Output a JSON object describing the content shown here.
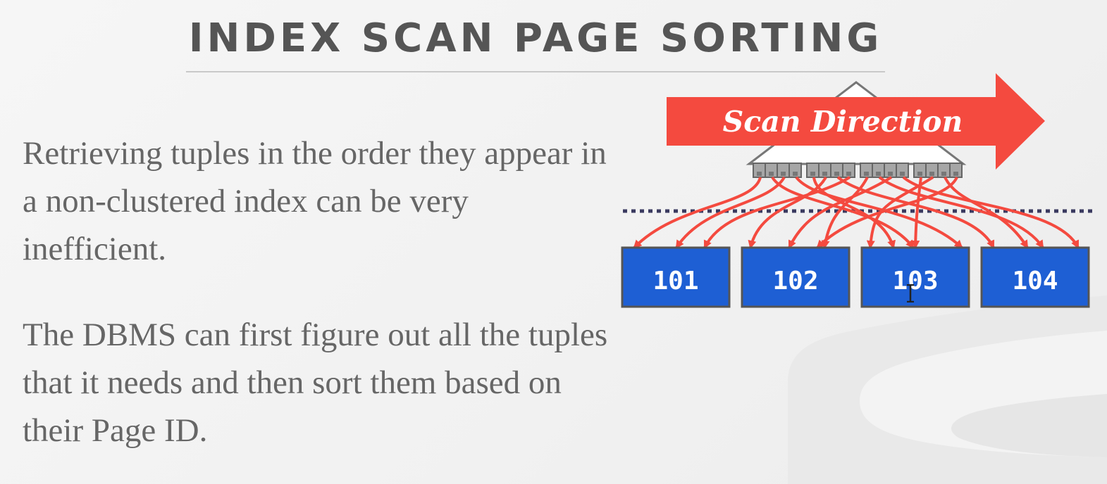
{
  "title": "INDEX SCAN PAGE SORTING",
  "paragraphs": [
    "Retrieving tuples in the order they appear in a non-clustered index can be very inefficient.",
    "The DBMS can first figure out all the tuples that it needs and then sort them based on their Page ID."
  ],
  "diagram": {
    "arrow_label": "Scan Direction",
    "pages": [
      "101",
      "102",
      "103",
      "104"
    ],
    "leaf_node_count": 4,
    "slots_per_leaf": 4
  },
  "colors": {
    "title": "#555555",
    "body_text": "#666666",
    "arrow": "#f44a3f",
    "page_fill": "#1e5fd4",
    "page_border": "#555555",
    "index_node": "#999999",
    "dotted_line": "#3a3a60"
  }
}
